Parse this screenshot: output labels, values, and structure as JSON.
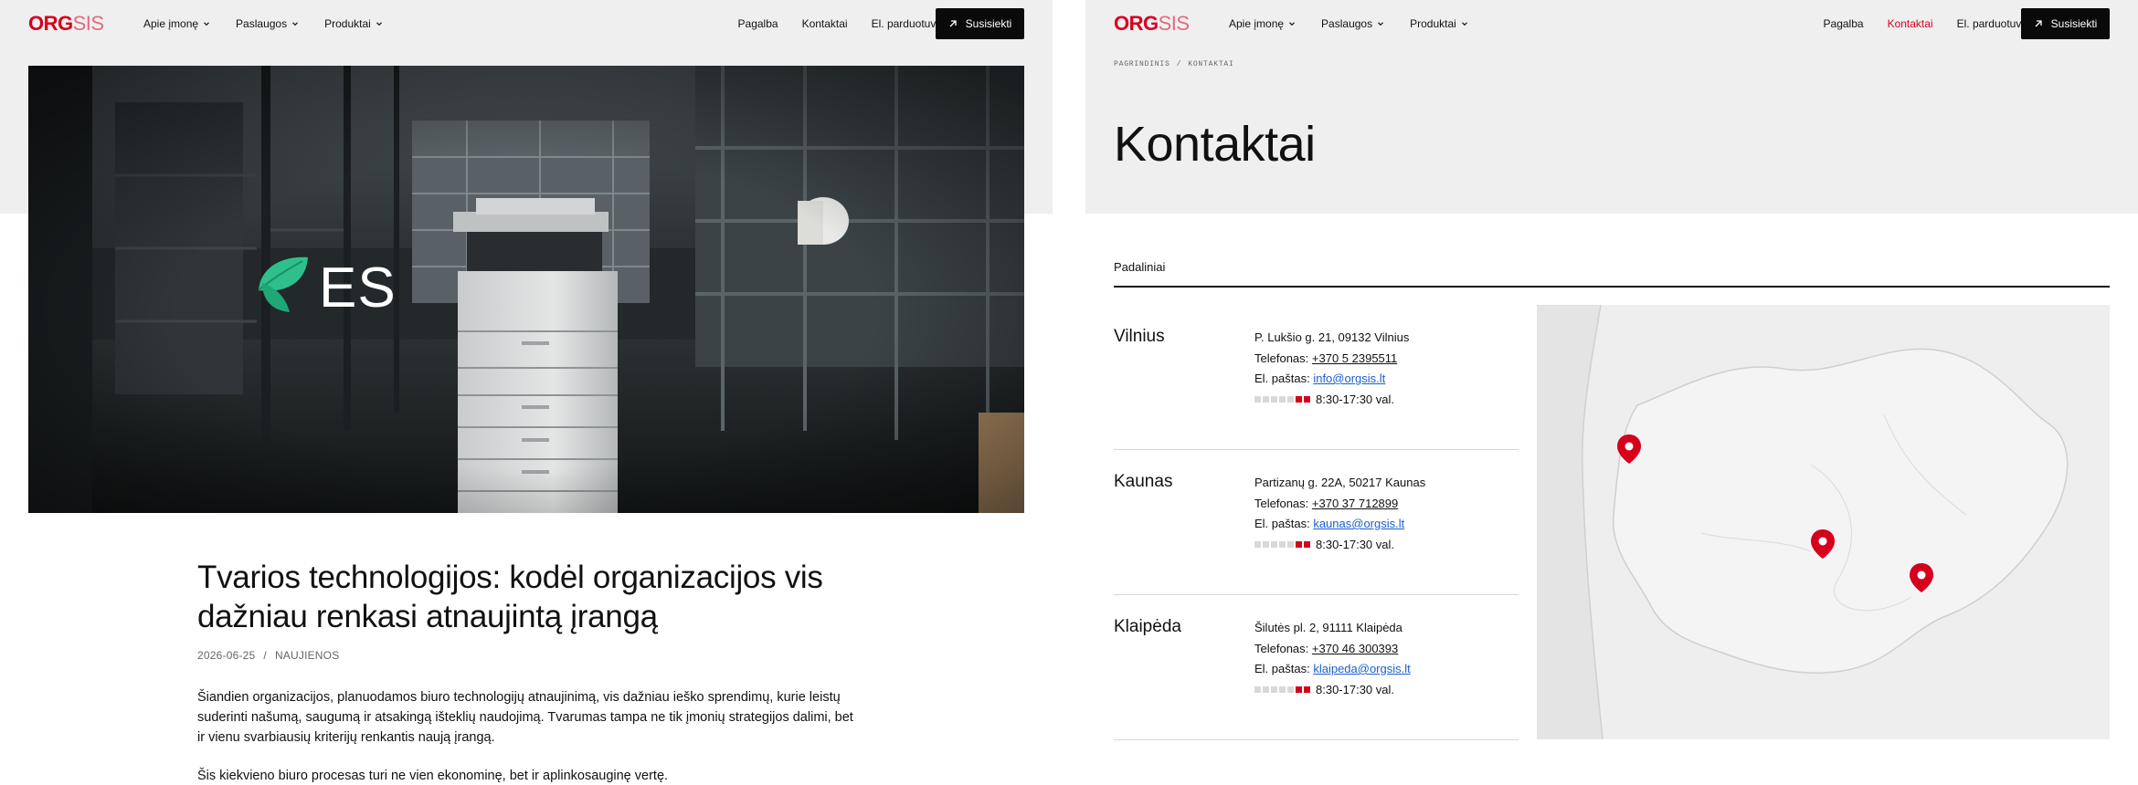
{
  "brand": {
    "logo_bold": "ORG",
    "logo_light": "SIS",
    "accent": "#d6001c"
  },
  "nav": {
    "left": [
      {
        "label": "Apie įmonę"
      },
      {
        "label": "Paslaugos"
      },
      {
        "label": "Produktai"
      }
    ],
    "right": [
      {
        "label": "Pagalba"
      },
      {
        "label": "Kontaktai"
      },
      {
        "label": "El. parduotuvė"
      }
    ],
    "cta": "Susisiekti"
  },
  "article": {
    "hero_badge": "ES",
    "title": "Tvarios technologijos: kodėl organizacijos vis dažniau renkasi atnaujintą įrangą",
    "date": "2026-06-25",
    "category": "NAUJIENOS",
    "paragraph1": "Šiandien organizacijos, planuodamos biuro technologijų atnaujinimą, vis dažniau ieško sprendimų, kurie leistų suderinti našumą, saugumą ir atsakingą išteklių naudojimą. Tvarumas tampa ne tik įmonių strategijos dalimi, bet ir vienu svarbiausių kriterijų renkantis naują įrangą.",
    "paragraph2": "Šis kiekvieno biuro procesas turi ne vien ekonominę, bet ir aplinkosauginę vertę."
  },
  "contacts": {
    "breadcrumb": [
      "PAGRINDINIS",
      "KONTAKTAI"
    ],
    "title": "Kontaktai",
    "tab": "Padaliniai",
    "offices": [
      {
        "city": "Vilnius",
        "address": "P. Lukšio g. 21, 09132 Vilnius",
        "phone_label": "Telefonas:",
        "phone": "+370 5 2395511",
        "email_label": "El. paštas:",
        "email": "info@orgsis.lt",
        "hours": "8:30-17:30 val."
      },
      {
        "city": "Kaunas",
        "address": "Partizanų g. 22A, 50217 Kaunas",
        "phone_label": "Telefonas:",
        "phone": "+370 37 712899",
        "email_label": "El. paštas:",
        "email": "kaunas@orgsis.lt",
        "hours": "8:30-17:30 val."
      },
      {
        "city": "Klaipėda",
        "address": "Šilutės pl. 2, 91111 Klaipėda",
        "phone_label": "Telefonas:",
        "phone": "+370 46 300393",
        "email_label": "El. paštas:",
        "email": "klaipeda@orgsis.lt",
        "hours": "8:30-17:30 val."
      }
    ],
    "workdays_active": [
      false,
      false,
      false,
      false,
      false,
      true,
      true
    ]
  }
}
